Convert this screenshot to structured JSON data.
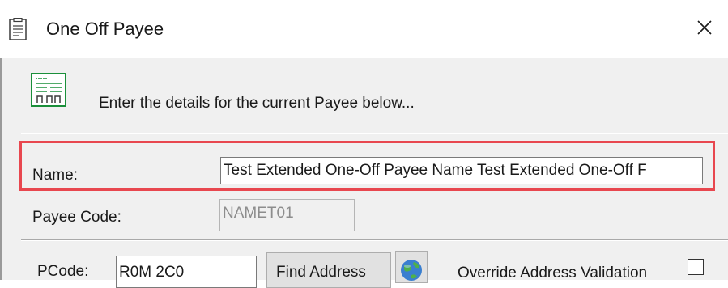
{
  "window": {
    "title": "One Off Payee",
    "title_icon": "document-icon",
    "close_icon": "close-icon"
  },
  "header": {
    "icon": "payee-document-icon",
    "text": "Enter the details for the current Payee below..."
  },
  "form": {
    "name_label": "Name:",
    "name_value": "Test Extended One-Off Payee Name Test Extended One-Off F",
    "payee_code_label": "Payee Code:",
    "payee_code_value": "NAMET01",
    "pcode_label": "PCode:",
    "pcode_value": "R0M 2C0",
    "find_address_label": "Find Address",
    "globe_icon": "globe-icon",
    "override_label": "Override Address Validation",
    "override_checked": false
  },
  "colors": {
    "highlight": "#e8474f",
    "dialog_bg": "#f0f0f0",
    "header_icon_green": "#1a8f3a"
  }
}
